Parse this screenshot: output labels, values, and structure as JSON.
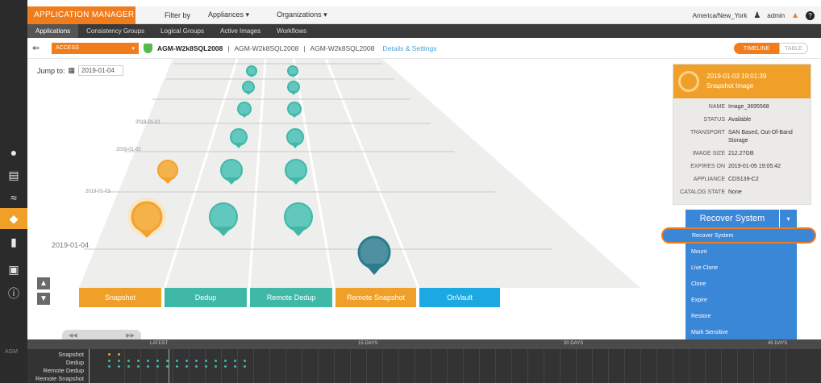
{
  "header": {
    "app_title": "APPLICATION MANAGER",
    "filter_by": "Filter by",
    "appliances": "Appliances",
    "organizations": "Organizations",
    "timezone": "America/New_York",
    "user": "admin"
  },
  "tabs": [
    "Applications",
    "Consistency Groups",
    "Logical Groups",
    "Active Images",
    "Workflows"
  ],
  "toolbar": {
    "access": "ACCESS",
    "app_name": "AGM-W2k8SQL2008",
    "host1": "AGM-W2k8SQL2008",
    "host2": "AGM-W2k8SQL2008",
    "details_link": "Details & Settings",
    "timeline": "TIMELINE",
    "table": "TABLE"
  },
  "jump": {
    "label": "Jump to:",
    "value": "2019-01-04"
  },
  "row_dates": [
    "2019-01-04",
    "2019-01-03",
    "2019-01-02",
    "2019-01-01"
  ],
  "categories": [
    {
      "label": "Snapshot",
      "color": "#f0a028"
    },
    {
      "label": "Dedup",
      "color": "#3fb8a8"
    },
    {
      "label": "Remote Dedup",
      "color": "#3fb8a8"
    },
    {
      "label": "Remote Snapshot",
      "color": "#f0a028"
    },
    {
      "label": "OnVault",
      "color": "#1ca8e0"
    }
  ],
  "details": {
    "time": "2019-01-03 19:01:39",
    "type": "Snapshot Image",
    "fields": [
      {
        "k": "NAME",
        "v": "Image_3695568"
      },
      {
        "k": "STATUS",
        "v": "Available"
      },
      {
        "k": "TRANSPORT",
        "v": "SAN Based, Out-Of-Band Storage"
      },
      {
        "k": "IMAGE SIZE",
        "v": "212.27GB"
      },
      {
        "k": "EXPIRES ON",
        "v": "2019-01-05 19:05:42"
      },
      {
        "k": "APPLIANCE",
        "v": "CDS139-C2"
      },
      {
        "k": "CATALOG STATE",
        "v": "None"
      }
    ]
  },
  "actions": {
    "primary": "Recover System",
    "menu": [
      "Recover System",
      "Mount",
      "Live Clone",
      "Clone",
      "Expire",
      "Restore",
      "Mark Sensitive"
    ]
  },
  "timeline": {
    "marks": [
      "LATEST",
      "15 DAYS",
      "30 DAYS",
      "45 DAYS"
    ],
    "rows": [
      "Snapshot",
      "Dedup",
      "Remote Dedup",
      "Remote Snapshot"
    ],
    "agm": "AGM"
  },
  "colors": {
    "accent": "#f07c1c",
    "teal": "#3fb8a8",
    "blue": "#3a87d8",
    "dark_teal": "#2a7d8c"
  }
}
